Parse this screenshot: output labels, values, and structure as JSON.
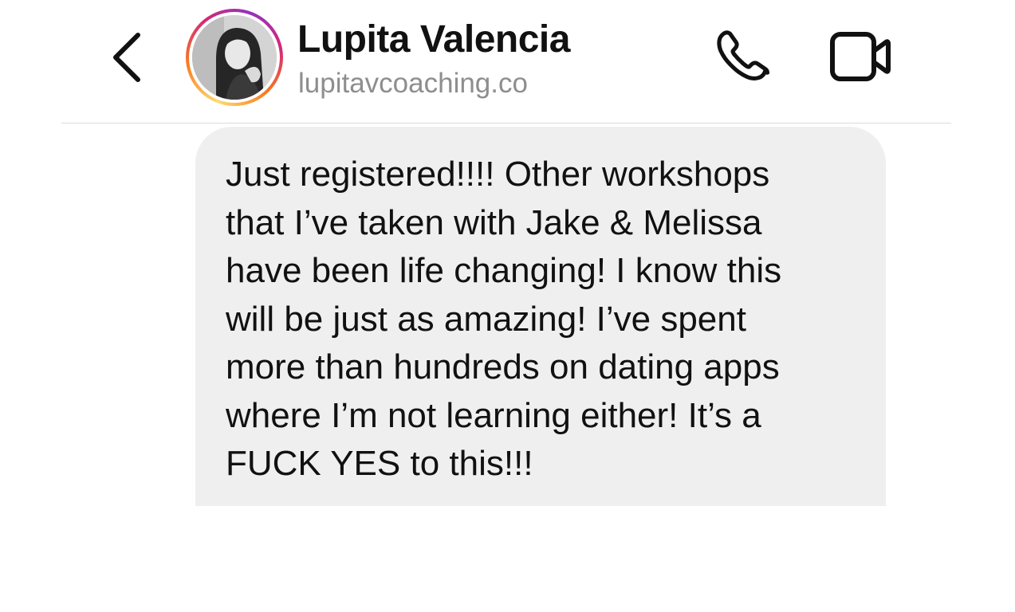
{
  "header": {
    "back_icon": "chevron-left-icon",
    "contact_name": "Lupita Valencia",
    "contact_subtitle": "lupitavcoaching.co",
    "story_ring_colors": [
      "#feda75",
      "#fa7e1e",
      "#d62976",
      "#962fbf"
    ],
    "call_icon": "phone-icon",
    "video_icon": "video-camera-icon"
  },
  "messages": [
    {
      "direction": "incoming",
      "text": "Just registered!!!! Other workshops\nthat I’ve taken with Jake & Melissa\nhave been life changing! I know this\nwill be just as amazing! I’ve spent\nmore than hundreds on dating apps\nwhere I’m not learning either! It’s a\nFUCK YES to this!!!"
    }
  ],
  "colors": {
    "bubble_bg": "#efefef",
    "subtitle_gray": "#8e8e8e",
    "divider": "#dbdbdb"
  }
}
